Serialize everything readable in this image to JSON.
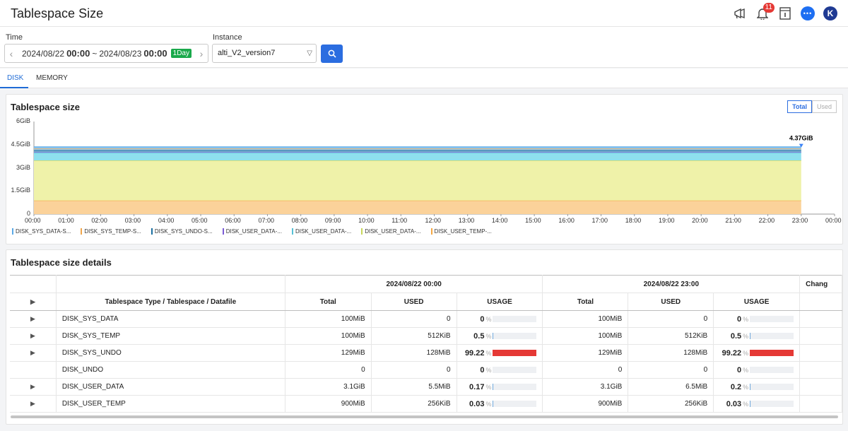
{
  "header": {
    "title": "Tablespace Size",
    "notification_count": "11",
    "avatar_initial": "K",
    "chat_label": "•••"
  },
  "filters": {
    "time_label": "Time",
    "time_start_date": "2024/08/22",
    "time_start_time": "00:00",
    "time_sep": "~",
    "time_end_date": "2024/08/23",
    "time_end_time": "00:00",
    "time_chip": "1Day",
    "instance_label": "Instance",
    "instance_value": "alti_V2_version7"
  },
  "tabs": [
    {
      "label": "DISK",
      "active": true
    },
    {
      "label": "MEMORY",
      "active": false
    }
  ],
  "chart_card": {
    "title": "Tablespace size",
    "toggle_total": "Total",
    "toggle_used": "Used"
  },
  "chart_data": {
    "type": "area",
    "title": "Tablespace size",
    "y_ticks": [
      "6GiB",
      "4.5GiB",
      "3GiB",
      "1.5GiB",
      "0"
    ],
    "ylim_gib": [
      0,
      6
    ],
    "x": [
      "00:00",
      "01:00",
      "02:00",
      "03:00",
      "04:00",
      "05:00",
      "06:00",
      "07:00",
      "08:00",
      "09:00",
      "10:00",
      "11:00",
      "12:00",
      "13:00",
      "14:00",
      "15:00",
      "16:00",
      "17:00",
      "18:00",
      "19:00",
      "20:00",
      "21:00",
      "22:00",
      "23:00",
      "00:00"
    ],
    "series": [
      {
        "name": "DISK_USER_TEMP-...",
        "color": "#f5a742",
        "fill": "#fbd29a",
        "values_gib": 0.88
      },
      {
        "name": "DISK_USER_DATA-...",
        "color": "#c8d65a",
        "fill": "#eff2a9",
        "values_gib": 2.6
      },
      {
        "name": "DISK_USER_DATA-...",
        "color": "#56c1d6",
        "fill": "#8ee0ee",
        "values_gib": 0.5
      },
      {
        "name": "DISK_USER_DATA-...",
        "color": "#7b5cd6",
        "fill": "#9fc7e8",
        "values_gib": 0.05
      },
      {
        "name": "DISK_SYS_UNDO-S...",
        "color": "#1a6fa0",
        "fill": "#6aa5c7",
        "values_gib": 0.13
      },
      {
        "name": "DISK_SYS_TEMP-S...",
        "color": "#f0a54a",
        "fill": "#a9cfe6",
        "values_gib": 0.1
      },
      {
        "name": "DISK_SYS_DATA-S...",
        "color": "#5aa9e6",
        "fill": "#8fc6ee",
        "values_gib": 0.1
      }
    ],
    "annotation": {
      "label": "4.37GiB",
      "x": "23:00",
      "value_gib": 4.37
    },
    "legend_placement": "bottom-left",
    "grid": false
  },
  "legend": [
    {
      "label": "DISK_SYS_DATA-S...",
      "color": "#5aa9e6"
    },
    {
      "label": "DISK_SYS_TEMP-S...",
      "color": "#f0a54a"
    },
    {
      "label": "DISK_SYS_UNDO-S...",
      "color": "#1a6fa0"
    },
    {
      "label": "DISK_USER_DATA-...",
      "color": "#7b5cd6"
    },
    {
      "label": "DISK_USER_DATA-...",
      "color": "#56c1d6"
    },
    {
      "label": "DISK_USER_DATA-...",
      "color": "#c8d65a"
    },
    {
      "label": "DISK_USER_TEMP-...",
      "color": "#f5a742"
    }
  ],
  "details_card": {
    "title": "Tablespace size details",
    "group1": "2024/08/22 00:00",
    "group2": "2024/08/22 23:00",
    "group3": "Chang",
    "col_name": "Tablespace Type / Tablespace / Datafile",
    "col_total": "Total",
    "col_used": "USED",
    "col_usage": "USAGE",
    "rows": [
      {
        "expand": true,
        "name": "DISK_SYS_DATA",
        "t1": "100MiB",
        "u1": "0",
        "p1": "0",
        "f1": 0,
        "t2": "100MiB",
        "u2": "0",
        "p2": "0",
        "f2": 0
      },
      {
        "expand": true,
        "name": "DISK_SYS_TEMP",
        "t1": "100MiB",
        "u1": "512KiB",
        "p1": "0.5",
        "f1": 0.5,
        "t2": "100MiB",
        "u2": "512KiB",
        "p2": "0.5",
        "f2": 0.5
      },
      {
        "expand": true,
        "name": "DISK_SYS_UNDO",
        "t1": "129MiB",
        "u1": "128MiB",
        "p1": "99.22",
        "f1": 99.22,
        "t2": "129MiB",
        "u2": "128MiB",
        "p2": "99.22",
        "f2": 99.22
      },
      {
        "expand": false,
        "name": "DISK_UNDO",
        "t1": "0",
        "u1": "0",
        "p1": "0",
        "f1": 0,
        "t2": "0",
        "u2": "0",
        "p2": "0",
        "f2": 0
      },
      {
        "expand": true,
        "name": "DISK_USER_DATA",
        "t1": "3.1GiB",
        "u1": "5.5MiB",
        "p1": "0.17",
        "f1": 0.17,
        "t2": "3.1GiB",
        "u2": "6.5MiB",
        "p2": "0.2",
        "f2": 0.2
      },
      {
        "expand": true,
        "name": "DISK_USER_TEMP",
        "t1": "900MiB",
        "u1": "256KiB",
        "p1": "0.03",
        "f1": 0.03,
        "t2": "900MiB",
        "u2": "256KiB",
        "p2": "0.03",
        "f2": 0.03
      }
    ]
  },
  "pct_symbol": "%",
  "caret_symbol": "▶"
}
